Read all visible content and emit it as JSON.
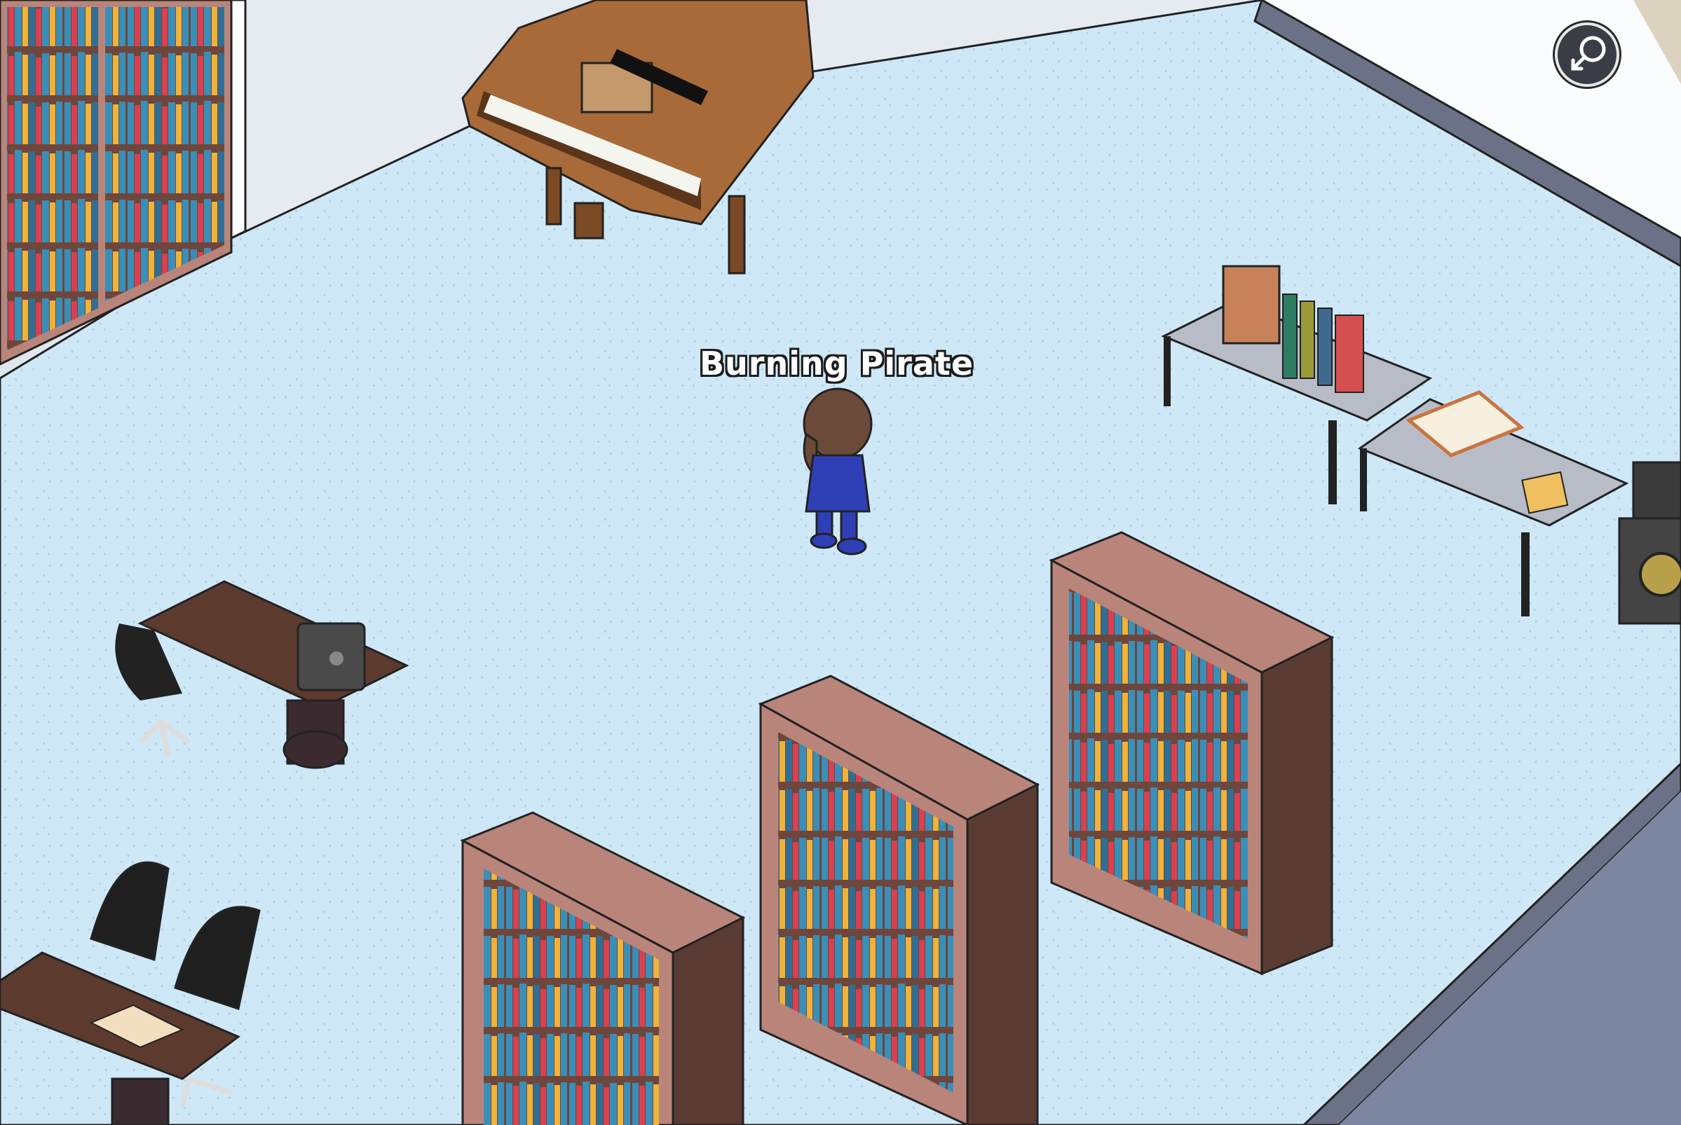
{
  "room": {
    "colors": {
      "floor": "#cfe8f7",
      "wall_left": "#e6ebf2",
      "wall_white": "#fbfcfd",
      "wall_beige": "#dcd2c0",
      "trim": "#5e6577",
      "bookcase_wood": "#b9857a",
      "bookcase_dark": "#5a3b33",
      "book_blue": "#3a8fb8",
      "book_red": "#d94050",
      "book_yellow": "#f0b33a",
      "desk_wood": "#5c3b2e",
      "piano": "#a86a38",
      "table_top": "#b7bcc6"
    }
  },
  "player": {
    "name": "Burning Pirate",
    "hair_color": "#6b4a3a",
    "outfit_color": "#2f3fb5"
  },
  "hud": {
    "zoom_button_icon": "magnifier-zoom-out-icon"
  }
}
